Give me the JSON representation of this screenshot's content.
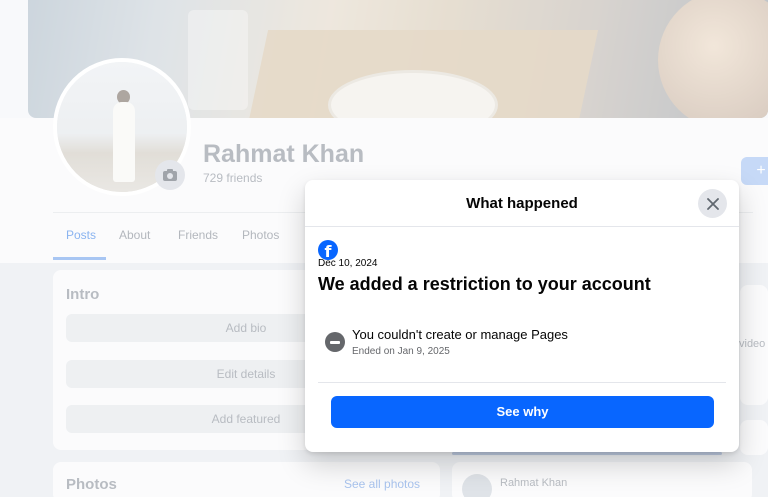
{
  "profile": {
    "name": "Rahmat Khan",
    "friends": "729 friends",
    "add_story_label": "+"
  },
  "tabs": [
    {
      "label": "Posts",
      "active": true
    },
    {
      "label": "About"
    },
    {
      "label": "Friends"
    },
    {
      "label": "Photos"
    }
  ],
  "intro": {
    "title": "Intro",
    "add_bio": "Add bio",
    "edit_details": "Edit details",
    "add_featured": "Add featured"
  },
  "photos_card": {
    "title": "Photos",
    "see_all": "See all photos"
  },
  "post_preview": {
    "author": "Rahmat Khan",
    "video_peek": "video"
  },
  "modal": {
    "title": "What happened",
    "date": "Dec 10, 2024",
    "heading": "We added a restriction to your account",
    "restriction_title": "You couldn't create or manage Pages",
    "restriction_ended": "Ended on Jan 9, 2025",
    "button_label": "See why",
    "logo_glyph": "f"
  },
  "icons": {
    "close": "close-icon",
    "camera": "camera-icon",
    "restriction": "minus-circle-icon",
    "logo": "facebook-logo-icon"
  },
  "colors": {
    "accent": "#0866ff",
    "text": "#050505",
    "secondary_text": "#65676b",
    "icon_bg": "#e4e6eb"
  }
}
